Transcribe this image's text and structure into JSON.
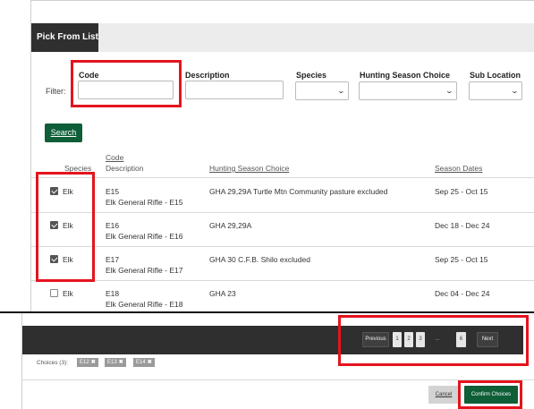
{
  "panel": {
    "title": "Pick From List"
  },
  "filter": {
    "label": "Filter:",
    "code_label": "Code",
    "description_label": "Description",
    "species_label": "Species",
    "hunting_season_label": "Hunting Season Choice",
    "sub_location_label": "Sub Location",
    "code_value": "",
    "description_value": ""
  },
  "search_button": "Search",
  "table": {
    "headers": {
      "species": "Species",
      "code": "Code",
      "description": "Description",
      "hunting_season": "Hunting Season Choice",
      "season_dates": "Season Dates"
    },
    "rows": [
      {
        "checked": true,
        "species": "Elk",
        "code": "E15",
        "description": "Elk General Rifle - E15",
        "hunting_season": "GHA 29,29A Turtle Mtn Community pasture excluded",
        "season_dates": "Sep 25 - Oct 15"
      },
      {
        "checked": true,
        "species": "Elk",
        "code": "E16",
        "description": "Elk General Rifle - E16",
        "hunting_season": "GHA 29,29A",
        "season_dates": "Dec 18 - Dec 24"
      },
      {
        "checked": true,
        "species": "Elk",
        "code": "E17",
        "description": "Elk General Rifle - E17",
        "hunting_season": "GHA 30 C.F.B. Shilo excluded",
        "season_dates": "Sep 25 - Oct 15"
      },
      {
        "checked": false,
        "species": "Elk",
        "code": "E18",
        "description": "Elk General Rifle - E18",
        "hunting_season": "GHA 23",
        "season_dates": "Dec 04 - Dec 24"
      }
    ]
  },
  "pagination": {
    "previous": "Previous",
    "pages": [
      "1",
      "2",
      "3"
    ],
    "ellipsis": "...",
    "last_page": "6",
    "next": "Next"
  },
  "choices": {
    "label": "Choices (3):",
    "items": [
      "E12",
      "E13",
      "E14"
    ],
    "remove_glyph": "✖"
  },
  "footer": {
    "cancel": "Cancel",
    "confirm": "Confirm Choices"
  },
  "colors": {
    "accent": "#0e5e37",
    "dark_bar": "#2f2f2f",
    "highlight": "#e4141e"
  }
}
